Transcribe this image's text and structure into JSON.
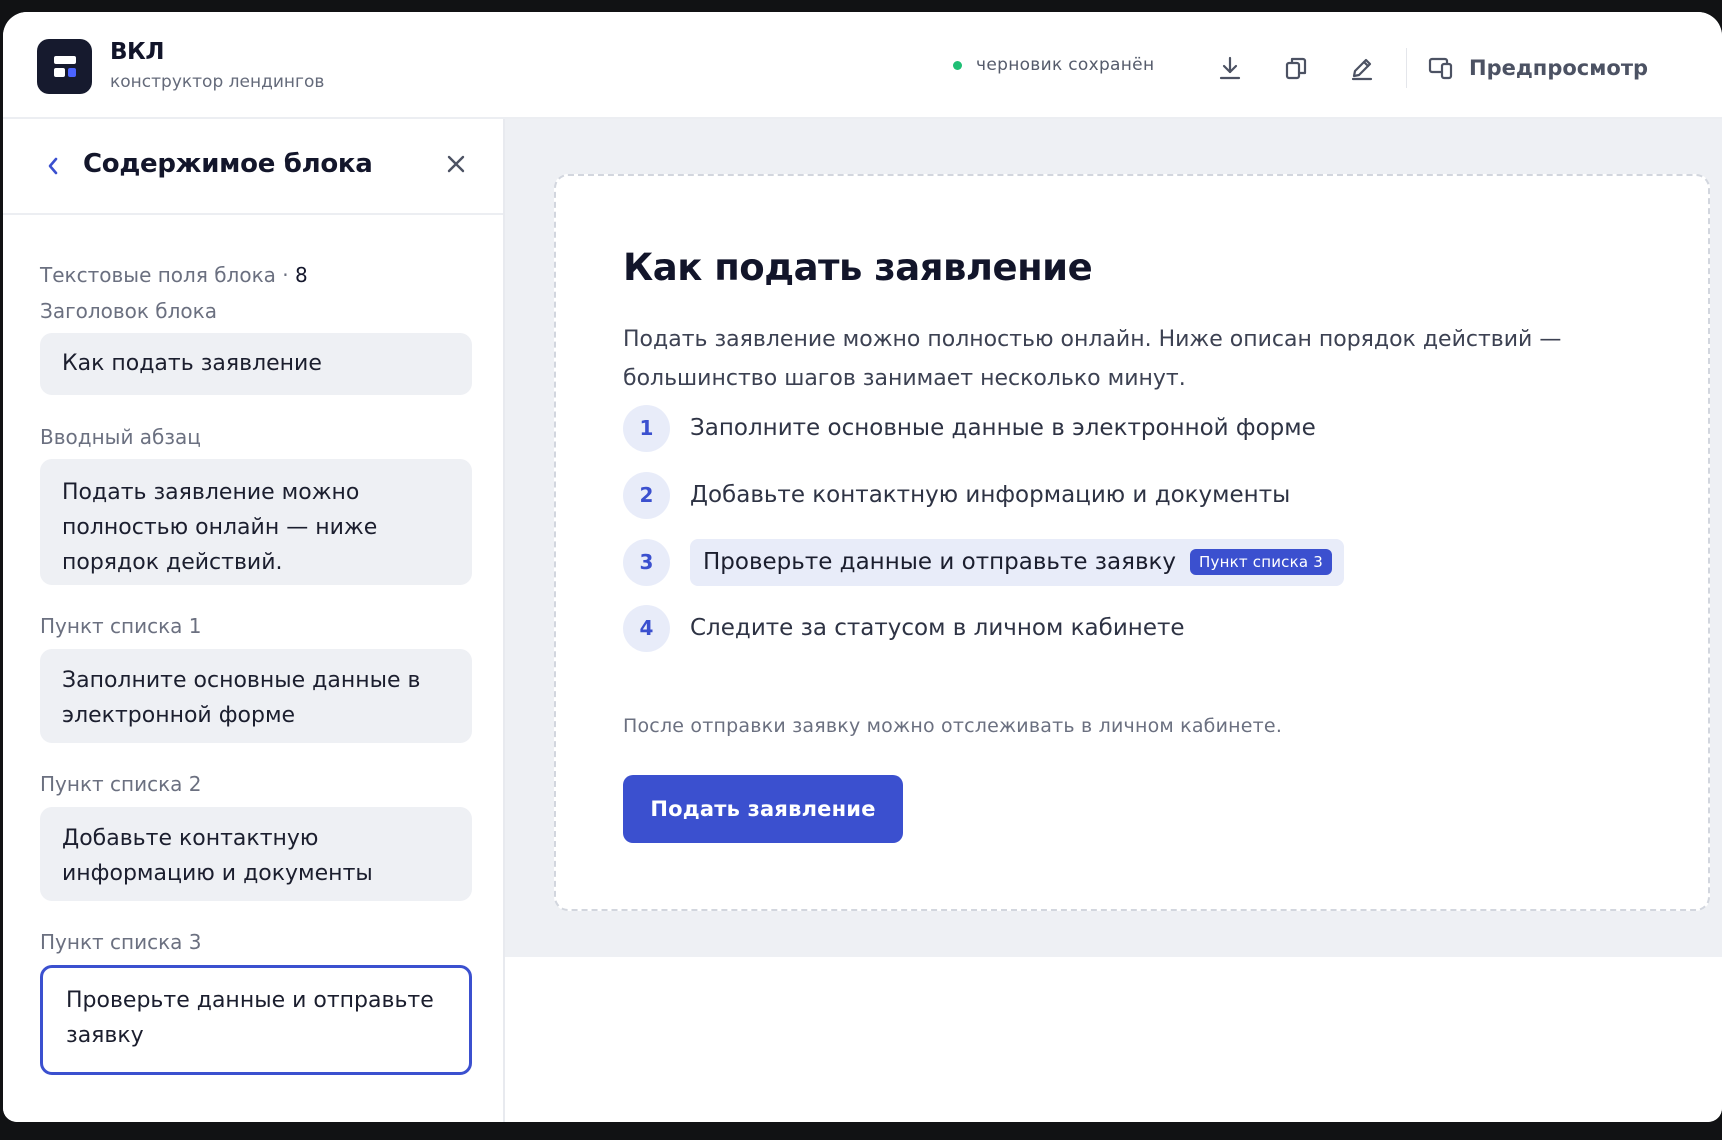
{
  "header": {
    "app_title": "ВКЛ",
    "app_subtitle": "конструктор лендингов",
    "status_text": "черновик сохранён",
    "preview_label": "Предпросмотр",
    "icons": [
      "download-icon",
      "copy-icon",
      "edit-icon",
      "preview-devices-icon"
    ],
    "status_color": "#1fbf75"
  },
  "sidebar": {
    "title": "Содержимое блока",
    "count_label": "Текстовые поля блока · ",
    "count_value": "8",
    "fields": [
      {
        "label": "Заголовок блока",
        "value": "Как подать заявление"
      },
      {
        "label": "Вводный абзац",
        "value": "Подать заявление можно полностью онлайн — ниже порядок действий."
      },
      {
        "label": "Пункт списка 1",
        "value": "Заполните основные данные в электронной форме"
      },
      {
        "label": "Пункт списка 2",
        "value": "Добавьте контактную информацию и документы"
      },
      {
        "label": "Пункт списка 3",
        "value": "Проверьте данные и отправьте заявку"
      }
    ]
  },
  "card": {
    "title": "Как подать заявление",
    "intro": "Подать заявление можно полностью онлайн. Ниже описан порядок действий — большинство шагов занимает несколько минут.",
    "steps": [
      {
        "num": "1",
        "text": "Заполните основные данные в электронной форме"
      },
      {
        "num": "2",
        "text": "Добавьте контактную информацию и документы"
      },
      {
        "num": "3",
        "text": "Проверьте данные и отправьте заявку",
        "badge": "Пункт списка 3"
      },
      {
        "num": "4",
        "text": "Следите за статусом в личном кабинете"
      }
    ],
    "note": "После отправки заявку можно отслеживать в личном кабинете.",
    "cta_label": "Подать заявление"
  },
  "colors": {
    "accent": "#3b50cf",
    "canvas_bg": "#eef0f4",
    "dark": "#161a2e"
  }
}
